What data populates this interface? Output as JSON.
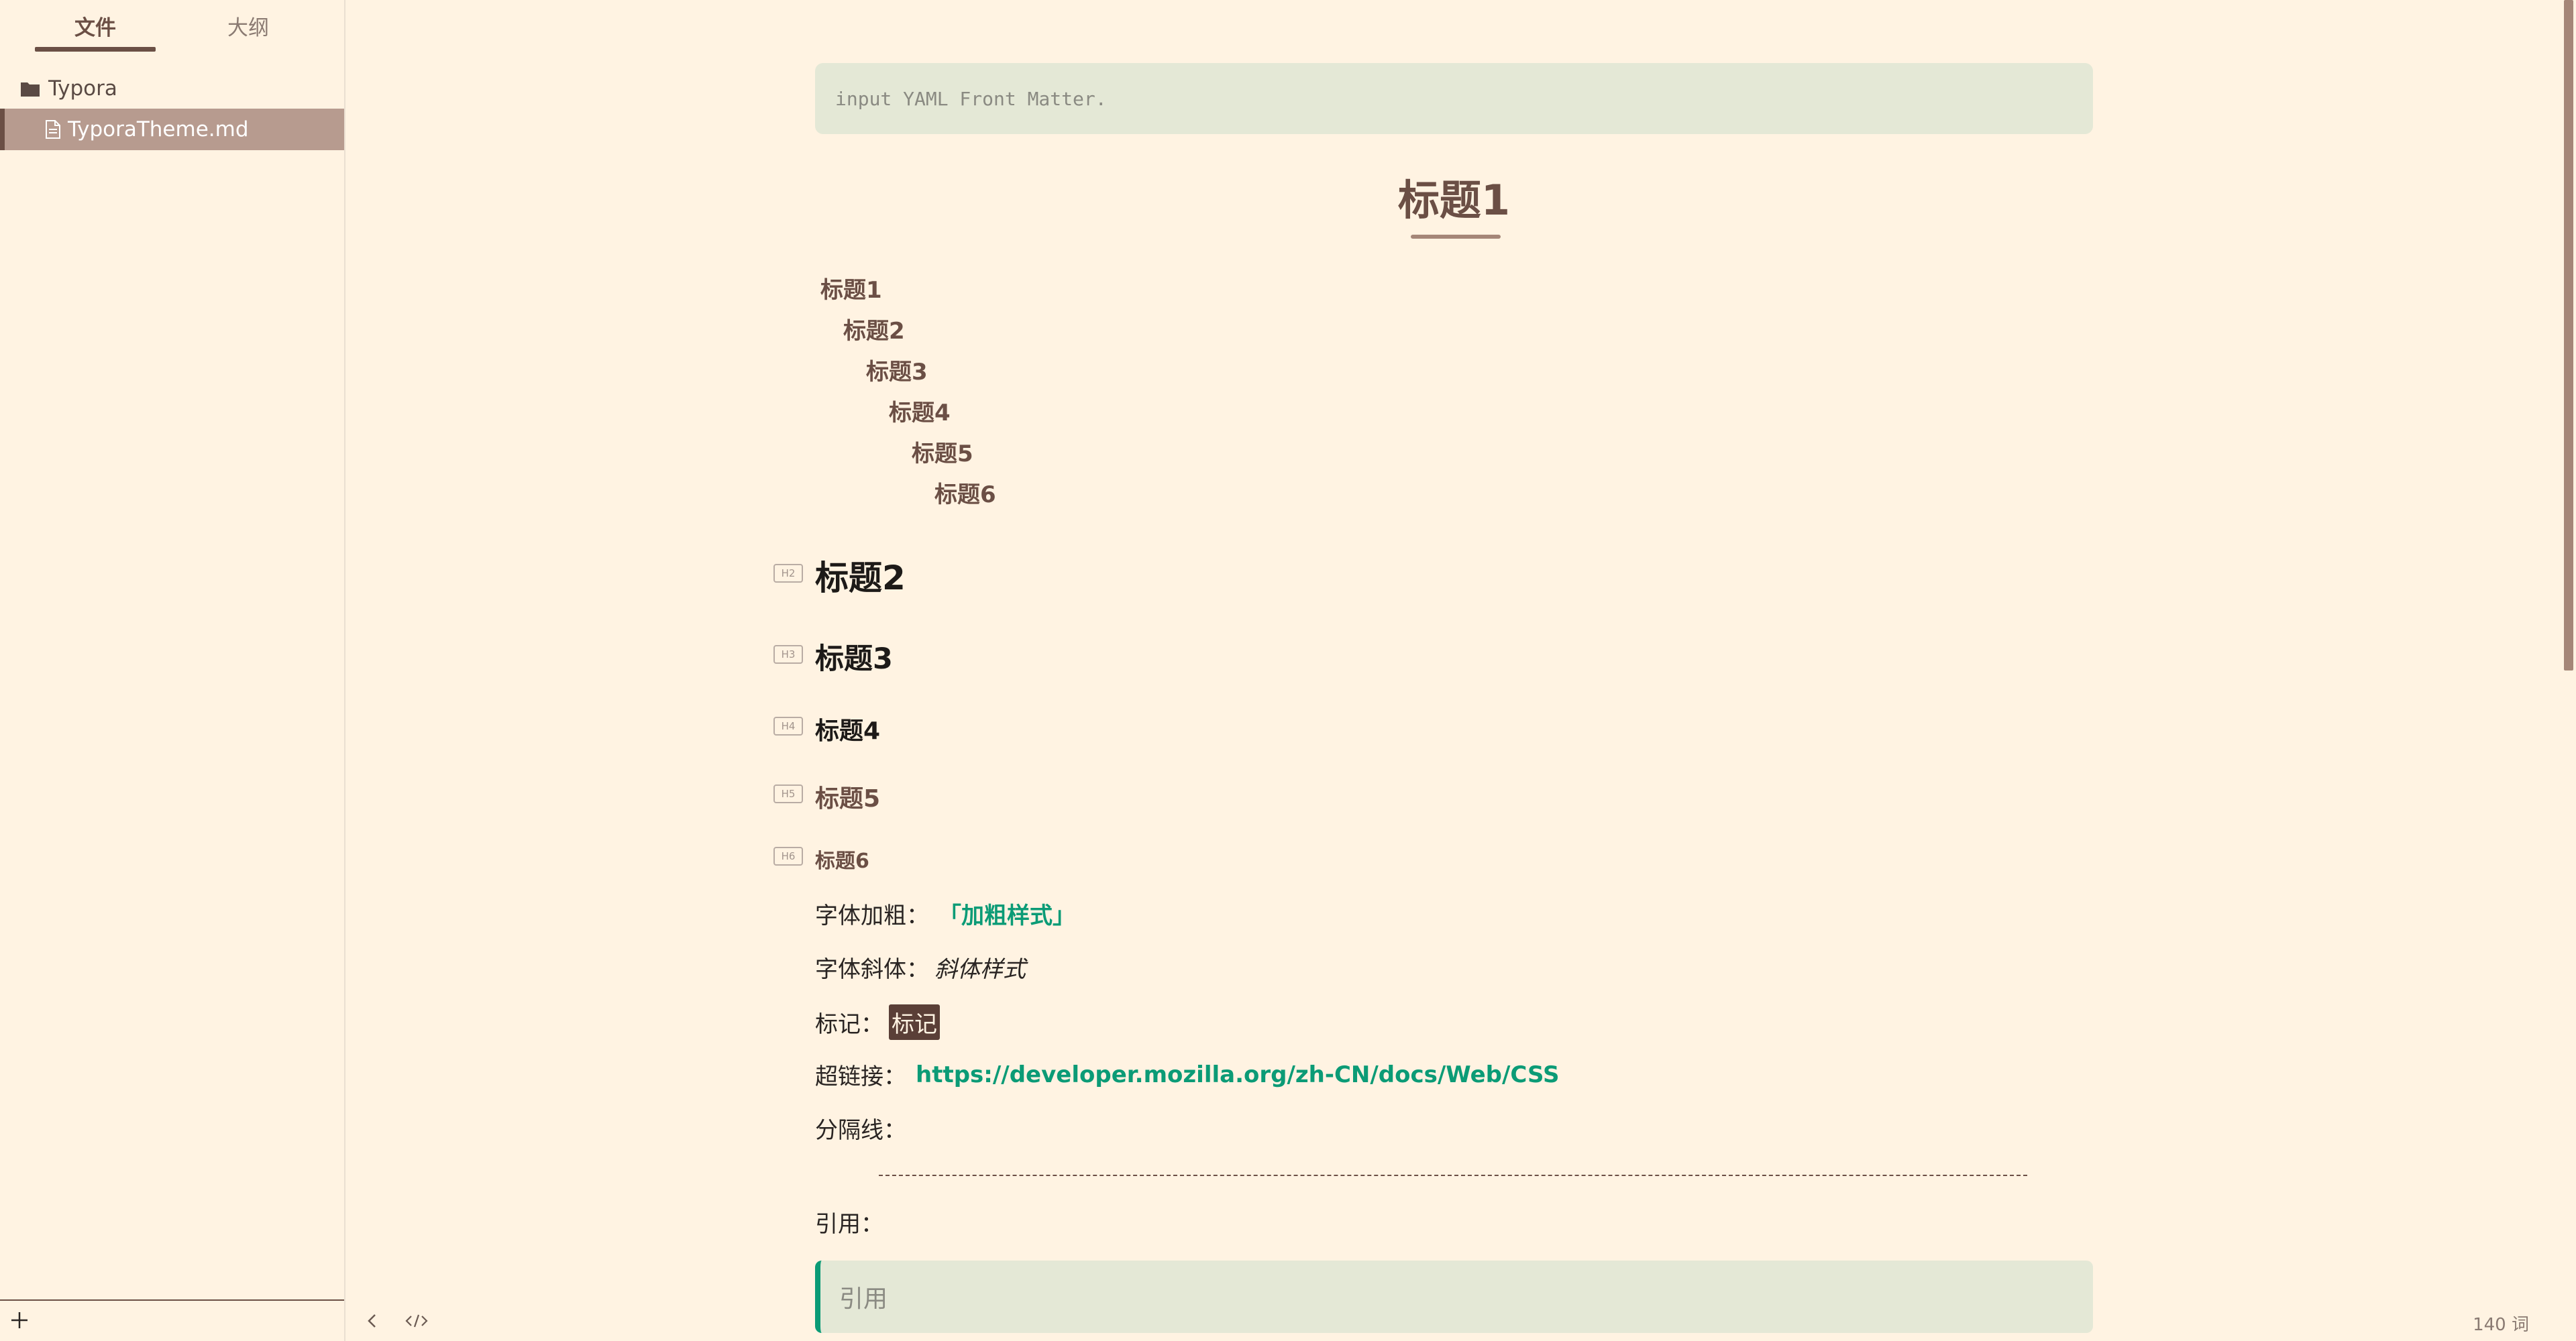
{
  "sidebar": {
    "tabs": {
      "files": "文件",
      "outline": "大纲"
    },
    "tree": {
      "root_folder": "Typora",
      "active_file": "TyporaTheme.md"
    }
  },
  "editor": {
    "yaml_placeholder": "input YAML Front Matter.",
    "h1": "标题1",
    "toc": [
      "标题1",
      "标题2",
      "标题3",
      "标题4",
      "标题5",
      "标题6"
    ],
    "headings": [
      {
        "tag": "H2",
        "text": "标题2"
      },
      {
        "tag": "H3",
        "text": "标题3"
      },
      {
        "tag": "H4",
        "text": "标题4"
      },
      {
        "tag": "H5",
        "text": "标题5"
      },
      {
        "tag": "H6",
        "text": "标题6"
      }
    ],
    "bold": {
      "label": "字体加粗：",
      "value": "「加粗样式」"
    },
    "italic": {
      "label": "字体斜体：",
      "value": "斜体样式"
    },
    "mark": {
      "label": "标记：",
      "value": "标记"
    },
    "link": {
      "label": "超链接：",
      "value": "https://developer.mozilla.org/zh-CN/docs/Web/CSS"
    },
    "hr_label": "分隔线：",
    "quote_label": "引用：",
    "quote_text": "引用"
  },
  "status": {
    "word_count": "140 词"
  },
  "colors": {
    "background": "#fff3e2",
    "accent_brown": "#6b4f45",
    "accent_green": "#0b9b76",
    "code_bg": "#e4e8d6",
    "selected_file_bg": "#b79b8f"
  },
  "icons": {
    "folder": "folder-icon",
    "file": "file-icon",
    "add": "add-icon",
    "back": "chevron-left-icon",
    "source": "source-code-icon"
  }
}
